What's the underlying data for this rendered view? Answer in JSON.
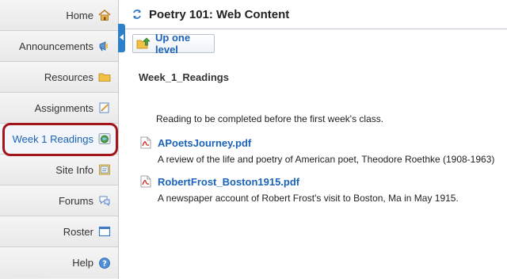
{
  "sidebar": {
    "items": [
      {
        "label": "Home",
        "icon": "home-icon"
      },
      {
        "label": "Announcements",
        "icon": "megaphone-icon"
      },
      {
        "label": "Resources",
        "icon": "folder-icon"
      },
      {
        "label": "Assignments",
        "icon": "assignment-icon"
      },
      {
        "label": "Week 1 Readings",
        "icon": "web-content-icon"
      },
      {
        "label": "Site Info",
        "icon": "site-info-icon"
      },
      {
        "label": "Forums",
        "icon": "forums-icon"
      },
      {
        "label": "Roster",
        "icon": "roster-icon"
      },
      {
        "label": "Help",
        "icon": "help-icon"
      }
    ],
    "active_index": 4
  },
  "header": {
    "title": "Poetry 101: Web Content"
  },
  "toolbar": {
    "up_label": "Up one level"
  },
  "folder": {
    "title": "Week_1_Readings",
    "intro": "Reading to be completed before the first week's class.",
    "files": [
      {
        "name": "APoetsJourney.pdf",
        "description": "A review of the life and poetry of American poet, Theodore Roethke (1908-1963)"
      },
      {
        "name": "RobertFrost_Boston1915.pdf",
        "description": "A newspaper account of Robert Frost's visit to Boston, Ma in May 1915."
      }
    ]
  },
  "colors": {
    "link": "#1a63b8",
    "highlight": "#a4151b",
    "tab": "#2c7fc9"
  }
}
